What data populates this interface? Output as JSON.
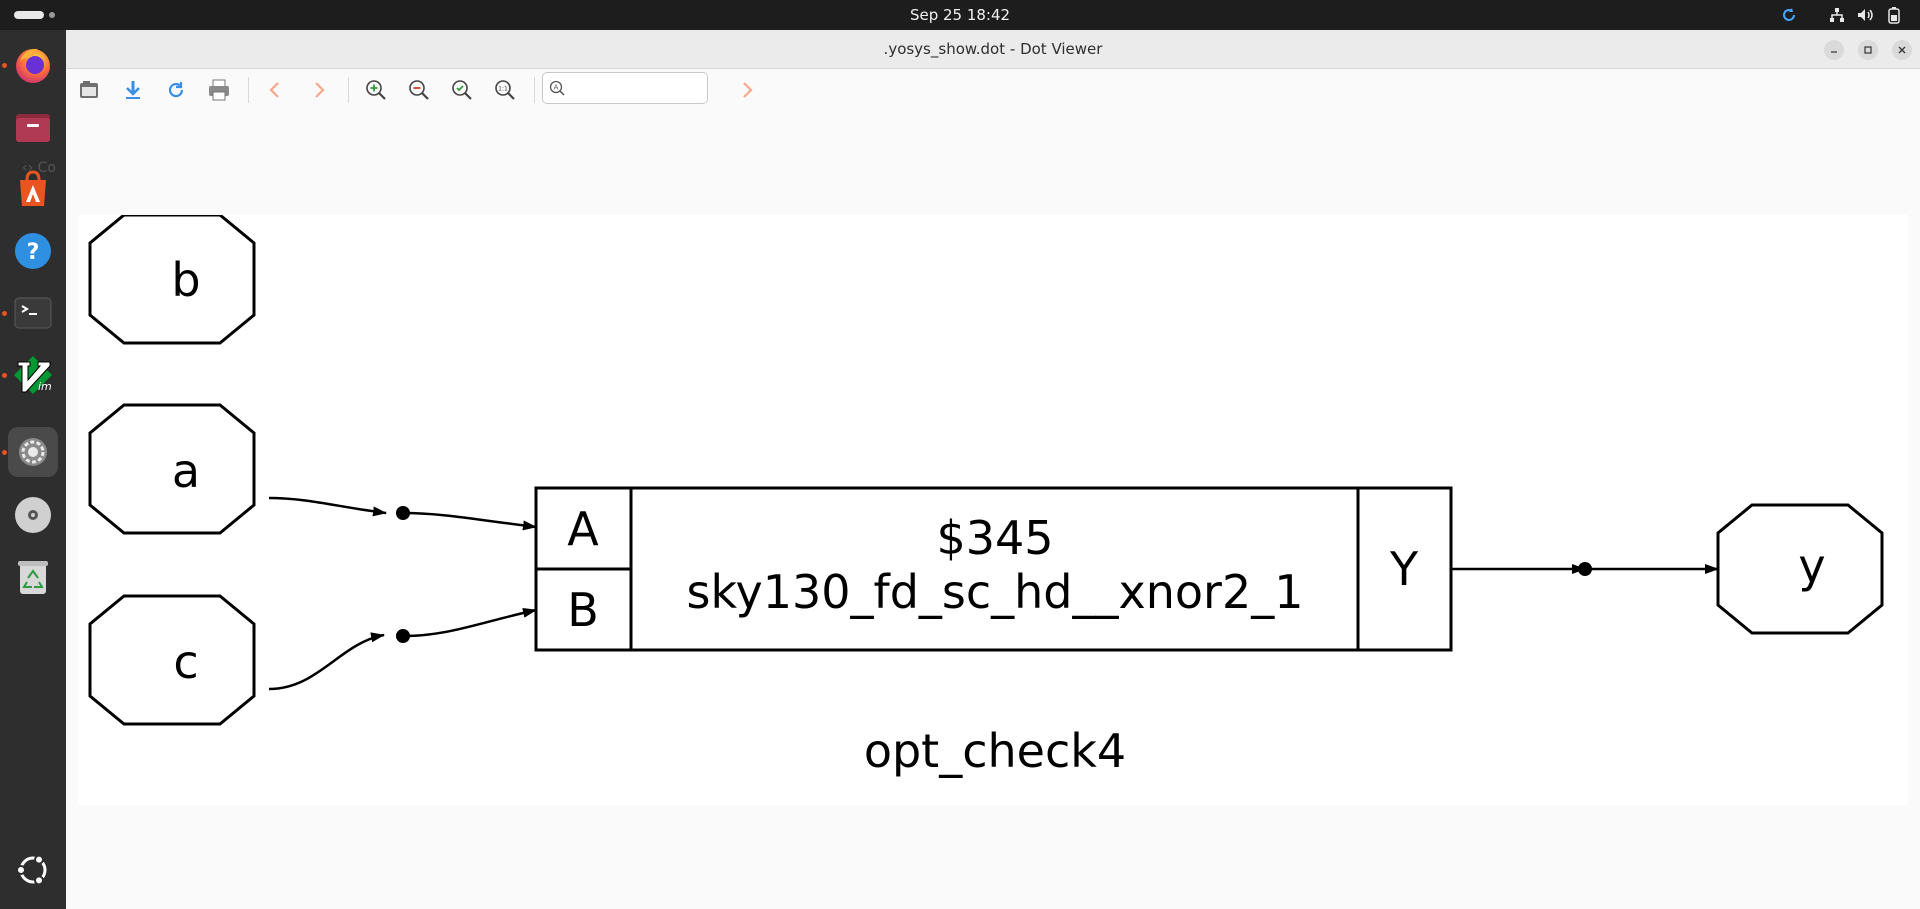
{
  "system": {
    "clock": "Sep 25  18:42"
  },
  "dock": {
    "apps": [
      {
        "name": "firefox-icon"
      },
      {
        "name": "files-icon"
      },
      {
        "name": "app-center-icon"
      },
      {
        "name": "help-icon"
      },
      {
        "name": "terminal-icon"
      },
      {
        "name": "vim-icon"
      },
      {
        "name": "settings-icon"
      },
      {
        "name": "disc-icon"
      },
      {
        "name": "trash-icon"
      }
    ]
  },
  "window": {
    "title": ".yosys_show.dot - Dot Viewer",
    "ghost_tab_text": "Co"
  },
  "toolbar": {
    "search_value": "",
    "buttons": [
      "open-icon",
      "save-icon",
      "reload-icon",
      "print-icon",
      "back-icon",
      "forward-icon",
      "zoom-in-icon",
      "zoom-out-icon",
      "zoom-fit-icon",
      "zoom-100-icon",
      "find-next-icon"
    ]
  },
  "graph": {
    "title": "opt_check4",
    "inputs": [
      "b",
      "a",
      "c"
    ],
    "output": "y",
    "cell": {
      "id": "$345",
      "type": "sky130_fd_sc_hd__xnor2_1",
      "in_ports": [
        "A",
        "B"
      ],
      "out_port": "Y"
    },
    "colors": {
      "stroke": "#000000",
      "background": "#ffffff"
    }
  }
}
